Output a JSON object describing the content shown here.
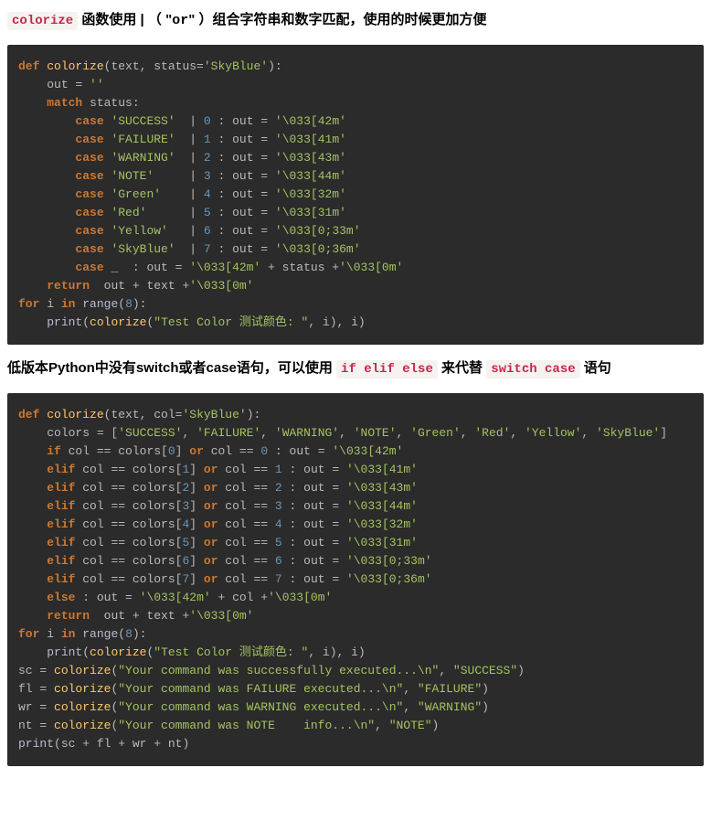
{
  "heading1": {
    "code": "colorize",
    "before_or": " 函数使用 | （ \"",
    "or_word": "or",
    "after_or": "\" ）组合字符串和数字匹配，使用的时候更加方便"
  },
  "heading2": {
    "text_before_code1": "低版本Python中没有switch或者case语句，可以使用 ",
    "code1": "if elif else",
    "text_mid": " 来代替 ",
    "code2": "switch case",
    "text_after": " 语句"
  },
  "code1": {
    "fn_def": {
      "kw": "def ",
      "name": "colorize",
      "params": "(text, status=",
      "default": "'SkyBlue'",
      "close": "):"
    },
    "out_init": {
      "indent": "    ",
      "lhs": "out = ",
      "val": "''"
    },
    "match": {
      "indent": "    ",
      "kw": "match ",
      "var": "status:"
    },
    "cases": [
      {
        "label": "'SUCCESS'",
        "pad": " ",
        "num": "0",
        "esc": "'\\033[42m'"
      },
      {
        "label": "'FAILURE'",
        "pad": " ",
        "num": "1",
        "esc": "'\\033[41m'"
      },
      {
        "label": "'WARNING'",
        "pad": " ",
        "num": "2",
        "esc": "'\\033[43m'"
      },
      {
        "label": "'NOTE'",
        "pad": "    ",
        "num": "3",
        "esc": "'\\033[44m'"
      },
      {
        "label": "'Green'",
        "pad": "   ",
        "num": "4",
        "esc": "'\\033[32m'"
      },
      {
        "label": "'Red'",
        "pad": "     ",
        "num": "5",
        "esc": "'\\033[31m'"
      },
      {
        "label": "'Yellow'",
        "pad": "  ",
        "num": "6",
        "esc": "'\\033[0;33m'"
      },
      {
        "label": "'SkyBlue'",
        "pad": " ",
        "num": "7",
        "esc": "'\\033[0;36m'"
      }
    ],
    "case_indent": "        ",
    "case_kw": "case ",
    "sep_pipe": " | ",
    "sep_colon": " : ",
    "out_assign": "out = ",
    "wildcard": {
      "label": "_ ",
      "esc1": "'\\033[42m'",
      "plus1": " + status +",
      "esc2": "'\\033[0m'"
    },
    "ret": {
      "indent": "    ",
      "kw": "return  ",
      "expr1": "out + text +",
      "esc": "'\\033[0m'"
    },
    "for": {
      "kw1": "for ",
      "var": "i ",
      "kw2": "in ",
      "call": "range",
      "arg": "(",
      "num": "8",
      "close": "):"
    },
    "print": {
      "indent": "    ",
      "call": "print",
      "open": "(",
      "fn": "colorize",
      "op2": "(",
      "str": "\"Test Color 测试颜色: \"",
      "comma": ", i), i)"
    }
  },
  "code2": {
    "fn_def": {
      "kw": "def ",
      "name": "colorize",
      "params": "(text, col=",
      "default": "'SkyBlue'",
      "close": "):"
    },
    "colors_line": {
      "indent": "    ",
      "lhs": "colors = [",
      "items": [
        "'SUCCESS'",
        "'FAILURE'",
        "'WARNING'",
        "'NOTE'",
        "'Green'",
        "'Red'",
        "'Yellow'",
        "'SkyBlue'"
      ],
      "sep": ", ",
      "close": "]"
    },
    "branches": [
      {
        "kw": "if",
        "idx": "0",
        "num": "0",
        "esc": "'\\033[42m'"
      },
      {
        "kw": "elif",
        "idx": "1",
        "num": "1",
        "esc": "'\\033[41m'"
      },
      {
        "kw": "elif",
        "idx": "2",
        "num": "2",
        "esc": "'\\033[43m'"
      },
      {
        "kw": "elif",
        "idx": "3",
        "num": "3",
        "esc": "'\\033[44m'"
      },
      {
        "kw": "elif",
        "idx": "4",
        "num": "4",
        "esc": "'\\033[32m'"
      },
      {
        "kw": "elif",
        "idx": "5",
        "num": "5",
        "esc": "'\\033[31m'"
      },
      {
        "kw": "elif",
        "idx": "6",
        "num": "6",
        "esc": "'\\033[0;33m'"
      },
      {
        "kw": "elif",
        "idx": "7",
        "num": "7",
        "esc": "'\\033[0;36m'"
      }
    ],
    "branch_indent": "    ",
    "branch_body1": " col == colors[",
    "branch_body2": "] ",
    "branch_or": "or",
    "branch_body3": " col == ",
    "branch_colon": " : ",
    "branch_out": "out = ",
    "else": {
      "kw": "else",
      "colon": " : ",
      "out": "out = ",
      "s1": "'\\033[42m'",
      "plus": " + col +",
      "s2": "'\\033[0m'"
    },
    "ret": {
      "indent": "    ",
      "kw": "return  ",
      "expr1": "out + text +",
      "esc": "'\\033[0m'"
    },
    "for": {
      "kw1": "for ",
      "var": "i ",
      "kw2": "in ",
      "call": "range",
      "arg": "(",
      "num": "8",
      "close": "):"
    },
    "print": {
      "indent": "    ",
      "call": "print",
      "open": "(",
      "fn": "colorize",
      "op2": "(",
      "str": "\"Test Color 测试颜色: \"",
      "comma": ", i), i)"
    },
    "assigns": [
      {
        "var": "sc",
        "str": "\"Your command was successfully executed...\\n\"",
        "tag": "\"SUCCESS\""
      },
      {
        "var": "fl",
        "str": "\"Your command was FAILURE executed...\\n\"",
        "tag": "\"FAILURE\""
      },
      {
        "var": "wr",
        "str": "\"Your command was WARNING executed...\\n\"",
        "tag": "\"WARNING\""
      },
      {
        "var": "nt",
        "str": "\"Your command was NOTE    info...\\n\"",
        "tag": "\"NOTE\""
      }
    ],
    "assign_eq": " = ",
    "assign_fn": "colorize",
    "assign_sep": ", ",
    "final_print": {
      "call": "print",
      "expr": "(sc + fl + wr + nt)"
    }
  }
}
